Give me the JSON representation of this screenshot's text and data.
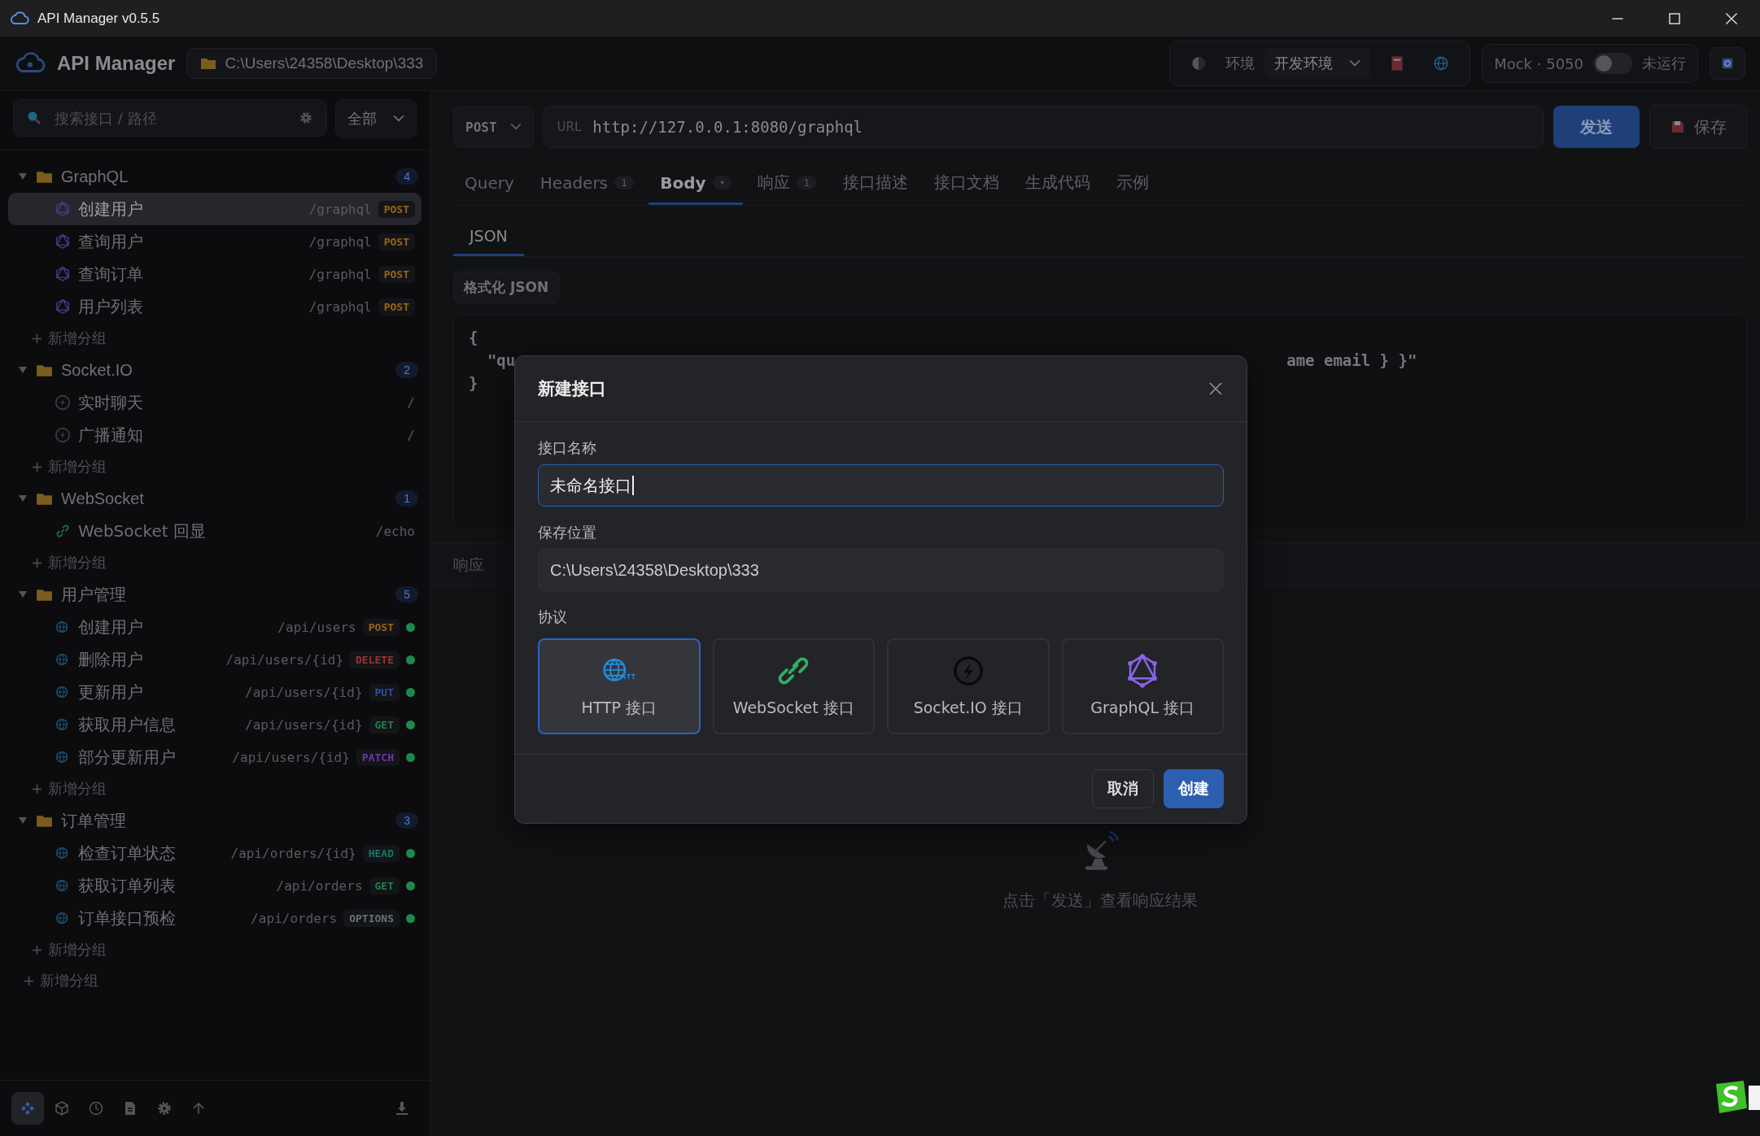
{
  "window": {
    "title": "API Manager v0.5.5"
  },
  "header": {
    "app_name": "API Manager",
    "project_path": "C:\\Users\\24358\\Desktop\\333",
    "env_label": "环境",
    "env_value": "开发环境",
    "mock_label": "Mock · 5050",
    "mock_on": false,
    "mock_status": "未运行"
  },
  "sidebar": {
    "search": {
      "placeholder": "搜索接口 / 路径"
    },
    "filter": "全部",
    "groups": [
      {
        "name": "GraphQL",
        "count": "4",
        "expanded": true,
        "add_label": "+ 新增分组",
        "items": [
          {
            "name": "创建用户",
            "path": "/graphql",
            "method": "POST",
            "kind": "graphql",
            "color": "#9a6414",
            "dot": false,
            "selected": true
          },
          {
            "name": "查询用户",
            "path": "/graphql",
            "method": "POST",
            "kind": "graphql",
            "color": "#9a6414",
            "dot": false,
            "selected": false
          },
          {
            "name": "查询订单",
            "path": "/graphql",
            "method": "POST",
            "kind": "graphql",
            "color": "#9a6414",
            "dot": false,
            "selected": false
          },
          {
            "name": "用户列表",
            "path": "/graphql",
            "method": "POST",
            "kind": "graphql",
            "color": "#9a6414",
            "dot": false,
            "selected": false
          }
        ]
      },
      {
        "name": "Socket.IO",
        "count": "2",
        "expanded": true,
        "add_label": "+ 新增分组",
        "items": [
          {
            "name": "实时聊天",
            "path": "/",
            "kind": "socketio",
            "dot": false,
            "selected": false
          },
          {
            "name": "广播通知",
            "path": "/",
            "kind": "socketio",
            "dot": false,
            "selected": false
          }
        ]
      },
      {
        "name": "WebSocket",
        "count": "1",
        "expanded": true,
        "add_label": "+ 新增分组",
        "items": [
          {
            "name": "WebSocket 回显",
            "path": "/echo",
            "kind": "websocket",
            "dot": false,
            "selected": false
          }
        ]
      },
      {
        "name": "用户管理",
        "count": "5",
        "expanded": true,
        "add_label": "+ 新增分组",
        "items": [
          {
            "name": "创建用户",
            "path": "/api/users",
            "method": "POST",
            "kind": "http",
            "color": "#9a6414",
            "dot": true,
            "selected": false
          },
          {
            "name": "删除用户",
            "path": "/api/users/{id}",
            "method": "DELETE",
            "kind": "http",
            "color": "#9a3434",
            "dot": true,
            "selected": false
          },
          {
            "name": "更新用户",
            "path": "/api/users/{id}",
            "method": "PUT",
            "kind": "http",
            "color": "#2a50a0",
            "dot": true,
            "selected": false
          },
          {
            "name": "获取用户信息",
            "path": "/api/users/{id}",
            "method": "GET",
            "kind": "http",
            "color": "#22804a",
            "dot": true,
            "selected": false
          },
          {
            "name": "部分更新用户",
            "path": "/api/users/{id}",
            "method": "PATCH",
            "kind": "http",
            "color": "#7038a8",
            "dot": true,
            "selected": false
          }
        ]
      },
      {
        "name": "订单管理",
        "count": "3",
        "expanded": true,
        "add_label": "+ 新增分组",
        "items": [
          {
            "name": "检查订单状态",
            "path": "/api/orders/{id}",
            "method": "HEAD",
            "kind": "http",
            "color": "#16786a",
            "dot": true,
            "selected": false
          },
          {
            "name": "获取订单列表",
            "path": "/api/orders",
            "method": "GET",
            "kind": "http",
            "color": "#22804a",
            "dot": true,
            "selected": false
          },
          {
            "name": "订单接口预检",
            "path": "/api/orders",
            "method": "OPTIONS",
            "kind": "http",
            "color": "#6a6e76",
            "dot": true,
            "selected": false
          }
        ]
      }
    ],
    "add_group": "+ 新增分组",
    "tools": [
      {
        "kind": "api",
        "selected": true
      },
      {
        "kind": "box",
        "selected": false
      },
      {
        "kind": "history",
        "selected": false
      },
      {
        "kind": "doc",
        "selected": false
      },
      {
        "kind": "settings",
        "selected": false
      },
      {
        "kind": "upload",
        "selected": false
      },
      {
        "kind": "download",
        "selected": false
      }
    ]
  },
  "request": {
    "method": "POST",
    "url_label": "URL",
    "url": "http://127.0.0.1:8080/graphql",
    "send": "发送",
    "save": "保存",
    "tabs": [
      {
        "label": "Query",
        "selected": false
      },
      {
        "label": "Headers",
        "badge": "1",
        "selected": false
      },
      {
        "label": "Body",
        "badge": "•",
        "selected": true
      },
      {
        "label": "响应",
        "badge": "1",
        "selected": false
      },
      {
        "label": "接口描述",
        "selected": false
      },
      {
        "label": "接口文档",
        "selected": false
      },
      {
        "label": "生成代码",
        "selected": false
      },
      {
        "label": "示例",
        "selected": false
      }
    ],
    "body_tabs": [
      {
        "label": "JSON",
        "selected": true
      }
    ],
    "format_button": "格式化 JSON",
    "code": [
      [
        "{"
      ],
      [
        "  \"qu",
        "ame email } }\""
      ],
      [
        "}"
      ]
    ],
    "response_label": "响应",
    "empty_text": "点击「发送」查看响应结果"
  },
  "dialog": {
    "title": "新建接口",
    "name_label": "接口名称",
    "name_value": "未命名接口",
    "location_label": "保存位置",
    "location_value": "C:\\Users\\24358\\Desktop\\333",
    "protocol_label": "协议",
    "protocols": [
      {
        "label": "HTTP 接口",
        "kind": "http",
        "selected": true
      },
      {
        "label": "WebSocket 接口",
        "kind": "websocket",
        "selected": false
      },
      {
        "label": "Socket.IO 接口",
        "kind": "socketio",
        "selected": false
      },
      {
        "label": "GraphQL 接口",
        "kind": "graphql",
        "selected": false
      }
    ],
    "cancel": "取消",
    "create": "创建"
  }
}
